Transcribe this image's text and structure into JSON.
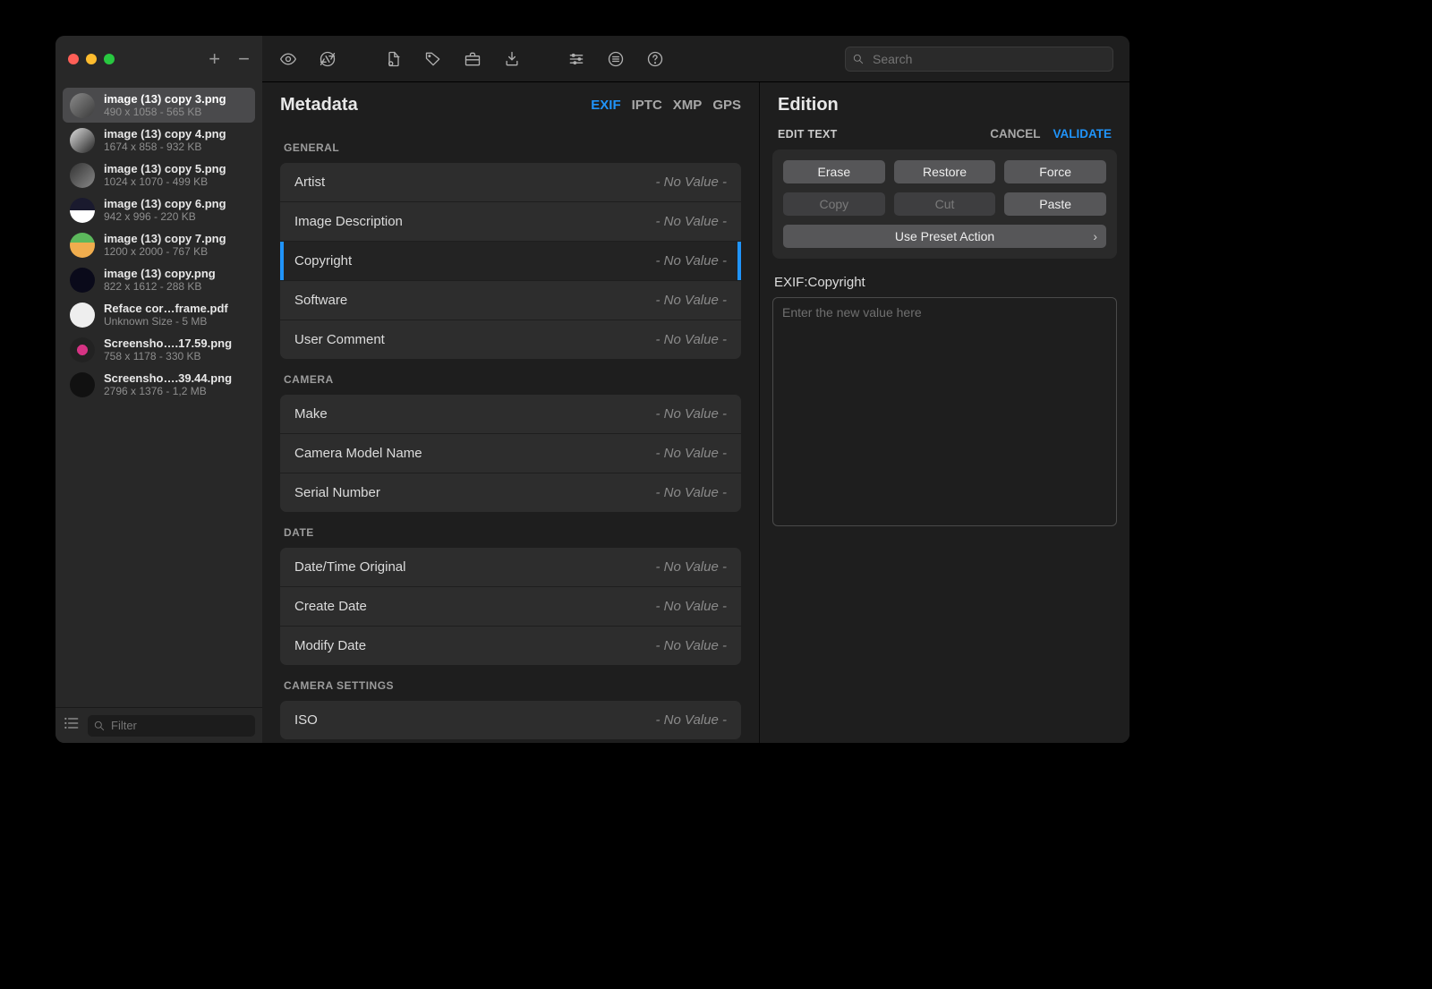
{
  "sidebar": {
    "filter_placeholder": "Filter",
    "files": [
      {
        "name": "image (13) copy 3.png",
        "dim": "490 x 1058 - 565 KB"
      },
      {
        "name": "image (13) copy 4.png",
        "dim": "1674 x 858 - 932 KB"
      },
      {
        "name": "image (13) copy 5.png",
        "dim": "1024 x 1070 - 499 KB"
      },
      {
        "name": "image (13) copy 6.png",
        "dim": "942 x 996 - 220 KB"
      },
      {
        "name": "image (13) copy 7.png",
        "dim": "1200 x 2000 - 767 KB"
      },
      {
        "name": "image (13) copy.png",
        "dim": "822 x 1612 - 288 KB"
      },
      {
        "name": "Reface cor…frame.pdf",
        "dim": "Unknown Size - 5 MB"
      },
      {
        "name": "Screensho….17.59.png",
        "dim": "758 x 1178 - 330 KB"
      },
      {
        "name": "Screensho….39.44.png",
        "dim": "2796 x 1376 - 1,2 MB"
      }
    ]
  },
  "toolbar": {
    "search_placeholder": "Search"
  },
  "meta": {
    "title": "Metadata",
    "tabs": [
      "EXIF",
      "IPTC",
      "XMP",
      "GPS"
    ],
    "no_value": "- No Value -",
    "sections": [
      {
        "name": "GENERAL",
        "rows": [
          "Artist",
          "Image Description",
          "Copyright",
          "Software",
          "User Comment"
        ]
      },
      {
        "name": "CAMERA",
        "rows": [
          "Make",
          "Camera Model Name",
          "Serial Number"
        ]
      },
      {
        "name": "DATE",
        "rows": [
          "Date/Time Original",
          "Create Date",
          "Modify Date"
        ]
      },
      {
        "name": "CAMERA SETTINGS",
        "rows": [
          "ISO"
        ]
      }
    ]
  },
  "edition": {
    "title": "Edition",
    "subtitle": "EDIT TEXT",
    "cancel": "CANCEL",
    "validate": "VALIDATE",
    "buttons": {
      "erase": "Erase",
      "restore": "Restore",
      "force": "Force",
      "copy": "Copy",
      "cut": "Cut",
      "paste": "Paste"
    },
    "preset": "Use Preset Action",
    "field": "EXIF:Copyright",
    "placeholder": "Enter the new value here"
  }
}
